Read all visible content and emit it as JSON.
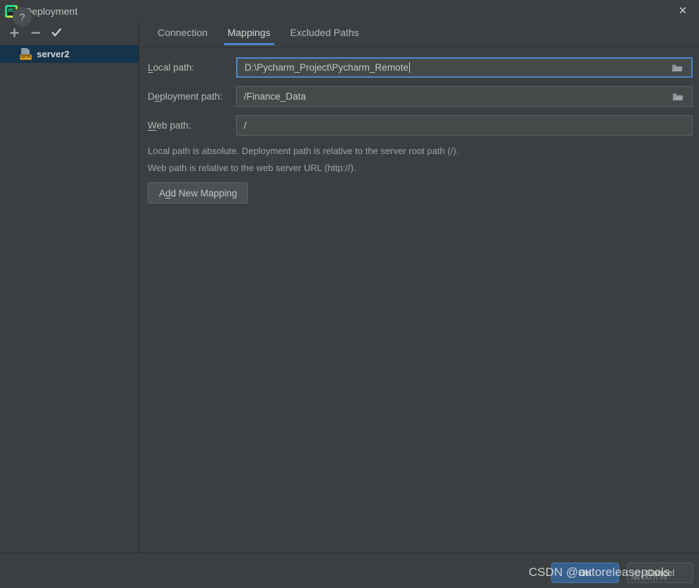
{
  "window": {
    "title": "Deployment",
    "logo_text": "PC",
    "close_label": "✕"
  },
  "sidebar": {
    "toolbar": [
      {
        "name": "add",
        "icon": "plus-icon",
        "label": "+"
      },
      {
        "name": "remove",
        "icon": "minus-icon",
        "label": "−"
      },
      {
        "name": "set-default",
        "icon": "check-icon",
        "label": "✓"
      }
    ],
    "servers": [
      {
        "label": "server2",
        "badge": "SFTP",
        "selected": true
      }
    ]
  },
  "tabs": [
    {
      "label": "Connection",
      "active": false
    },
    {
      "label": "Mappings",
      "active": true
    },
    {
      "label": "Excluded Paths",
      "active": false
    }
  ],
  "form": {
    "local_path": {
      "label_prefix": "",
      "label_mnemonic": "L",
      "label_suffix": "ocal path:",
      "value": "D:\\Pycharm_Project\\Pycharm_Remote",
      "browse_icon": "folder-icon",
      "focused": true
    },
    "deployment_path": {
      "label_prefix": "D",
      "label_mnemonic": "e",
      "label_suffix": "ployment path:",
      "value": "/Finance_Data",
      "browse_icon": "folder-icon",
      "focused": false
    },
    "web_path": {
      "label_prefix": "",
      "label_mnemonic": "W",
      "label_suffix": "eb path:",
      "value": "/",
      "browse_icon": "",
      "focused": false
    },
    "hint_line1": "Local path is absolute. Deployment path is relative to the server root path (/).",
    "hint_line2": "Web path is relative to the web server URL (http://).",
    "add_button": {
      "prefix": "A",
      "mnemonic": "d",
      "suffix": "d New Mapping"
    }
  },
  "footer": {
    "help_label": "?",
    "ok_label": "OK",
    "cancel_label": "Cancel"
  },
  "watermark": {
    "text": "CSDN @autoreleasepools",
    "overlay_text": "版权所有"
  },
  "colors": {
    "background": "#3c3f41",
    "field_background": "#45494a",
    "focus_border": "#4a88c7",
    "selection": "#15334a",
    "accent": "#4a88c7",
    "sftp_badge": "#d9a026",
    "primary_button": "#38608f"
  }
}
